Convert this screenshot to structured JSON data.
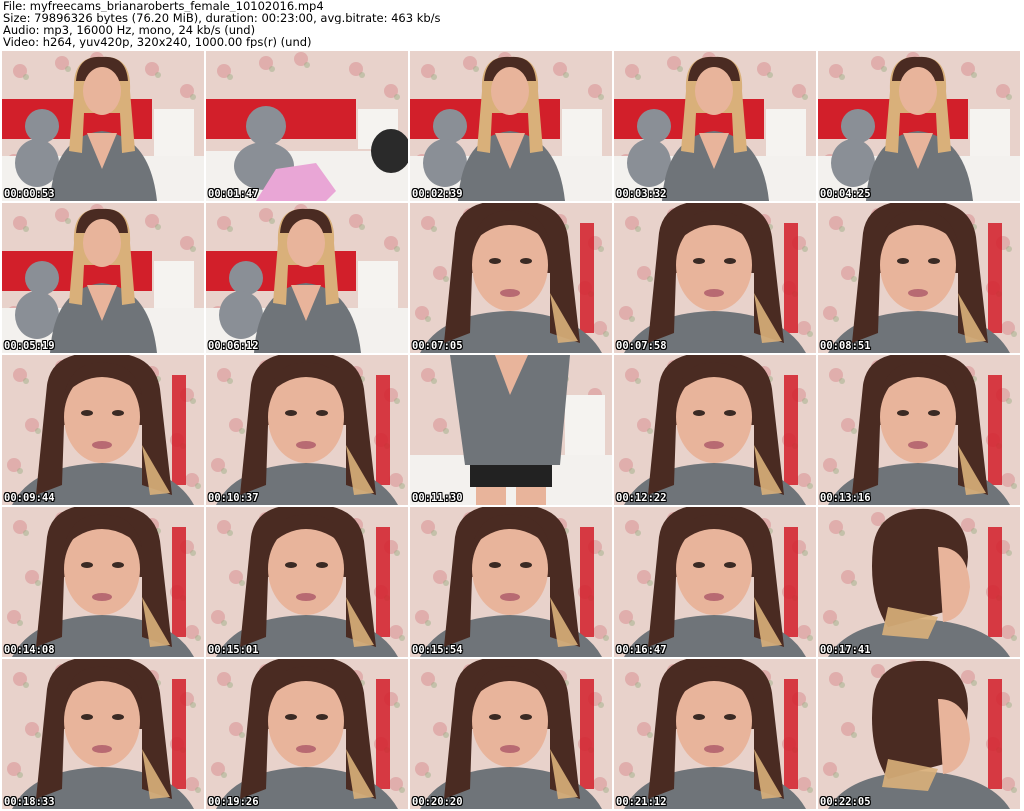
{
  "header": {
    "file": "File: myfreecams_brianaroberts_female_10102016.mp4",
    "size": "Size: 79896326 bytes (76.20 MiB), duration: 00:23:00, avg.bitrate: 463 kb/s",
    "audio": "Audio: mp3, 16000 Hz, mono, 24 kb/s (und)",
    "video": "Video: h264, yuv420p, 320x240, 1000.00 fps(r) (und)"
  },
  "colors": {
    "wall": "#e8d2cb",
    "flower": "#d98f93",
    "headboard": "#d21f2a",
    "sweater": "#6f7479",
    "skin": "#e8b49b",
    "hair_dark": "#4a2b22",
    "hair_blonde": "#d9b07a",
    "bear": "#8a8f96",
    "bedding": "#f3f1ee",
    "nightstand": "#f5f3f0",
    "timestamp_text": "#ffffff"
  },
  "thumbnails": [
    {
      "time": "00:00:53",
      "scene": "wide"
    },
    {
      "time": "00:01:47",
      "scene": "bed"
    },
    {
      "time": "00:02:39",
      "scene": "wide"
    },
    {
      "time": "00:03:32",
      "scene": "wide"
    },
    {
      "time": "00:04:25",
      "scene": "wide"
    },
    {
      "time": "00:05:19",
      "scene": "wide"
    },
    {
      "time": "00:06:12",
      "scene": "wide"
    },
    {
      "time": "00:07:05",
      "scene": "close"
    },
    {
      "time": "00:07:58",
      "scene": "close"
    },
    {
      "time": "00:08:51",
      "scene": "close"
    },
    {
      "time": "00:09:44",
      "scene": "close"
    },
    {
      "time": "00:10:37",
      "scene": "close"
    },
    {
      "time": "00:11:30",
      "scene": "standing"
    },
    {
      "time": "00:12:22",
      "scene": "close"
    },
    {
      "time": "00:13:16",
      "scene": "close"
    },
    {
      "time": "00:14:08",
      "scene": "close"
    },
    {
      "time": "00:15:01",
      "scene": "close"
    },
    {
      "time": "00:15:54",
      "scene": "close"
    },
    {
      "time": "00:16:47",
      "scene": "close"
    },
    {
      "time": "00:17:41",
      "scene": "profile"
    },
    {
      "time": "00:18:33",
      "scene": "close"
    },
    {
      "time": "00:19:26",
      "scene": "close"
    },
    {
      "time": "00:20:20",
      "scene": "close"
    },
    {
      "time": "00:21:12",
      "scene": "close"
    },
    {
      "time": "00:22:05",
      "scene": "profile"
    }
  ]
}
